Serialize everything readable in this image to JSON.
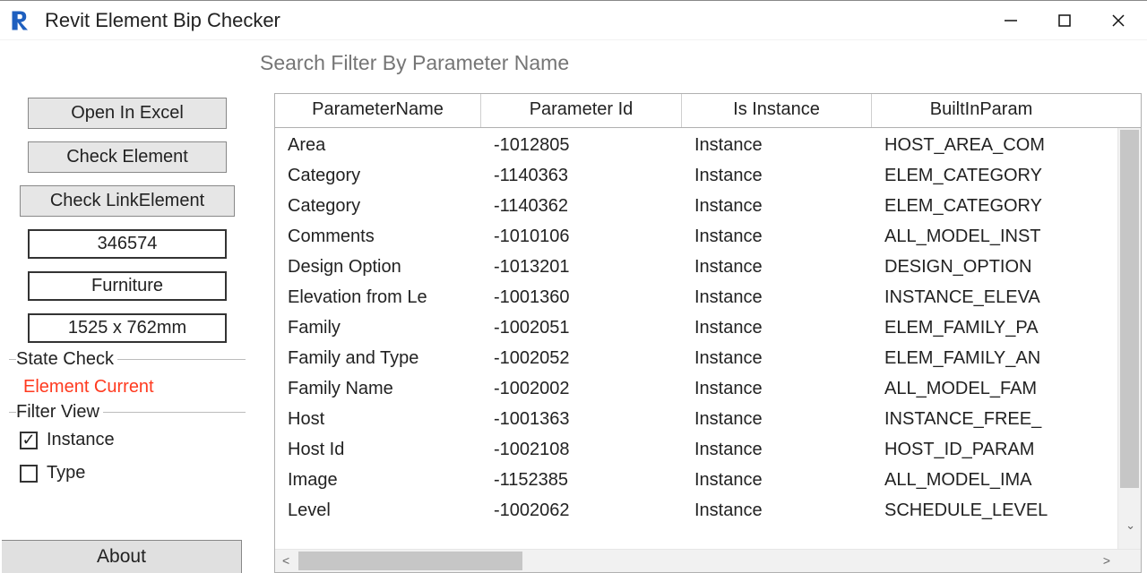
{
  "window": {
    "title": "Revit Element Bip Checker"
  },
  "search": {
    "placeholder": "Search Filter By Parameter Name"
  },
  "sidebar": {
    "open_excel": "Open In Excel",
    "check_element": "Check Element",
    "check_link": "Check LinkElement",
    "element_id": "346574",
    "category": "Furniture",
    "type_name": "1525 x 762mm",
    "state_group": "State Check",
    "state_value": "Element Current",
    "filter_group": "Filter View",
    "instance_label": "Instance",
    "type_label": "Type",
    "instance_checked": true,
    "type_checked": false,
    "about": "About"
  },
  "grid": {
    "columns": [
      "ParameterName",
      "Parameter Id",
      "Is Instance",
      "BuiltInParam"
    ],
    "rows": [
      {
        "name": "Area",
        "id": "-1012805",
        "inst": "Instance",
        "bip": "HOST_AREA_COM"
      },
      {
        "name": "Category",
        "id": "-1140363",
        "inst": "Instance",
        "bip": "ELEM_CATEGORY"
      },
      {
        "name": "Category",
        "id": "-1140362",
        "inst": "Instance",
        "bip": "ELEM_CATEGORY"
      },
      {
        "name": "Comments",
        "id": "-1010106",
        "inst": "Instance",
        "bip": "ALL_MODEL_INST"
      },
      {
        "name": "Design Option",
        "id": "-1013201",
        "inst": "Instance",
        "bip": "DESIGN_OPTION"
      },
      {
        "name": "Elevation from Le",
        "id": "-1001360",
        "inst": "Instance",
        "bip": "INSTANCE_ELEVA"
      },
      {
        "name": "Family",
        "id": "-1002051",
        "inst": "Instance",
        "bip": "ELEM_FAMILY_PA"
      },
      {
        "name": "Family and Type",
        "id": "-1002052",
        "inst": "Instance",
        "bip": "ELEM_FAMILY_AN"
      },
      {
        "name": "Family Name",
        "id": "-1002002",
        "inst": "Instance",
        "bip": "ALL_MODEL_FAM"
      },
      {
        "name": "Host",
        "id": "-1001363",
        "inst": "Instance",
        "bip": "INSTANCE_FREE_"
      },
      {
        "name": "Host Id",
        "id": "-1002108",
        "inst": "Instance",
        "bip": "HOST_ID_PARAM"
      },
      {
        "name": "Image",
        "id": "-1152385",
        "inst": "Instance",
        "bip": "ALL_MODEL_IMA"
      },
      {
        "name": "Level",
        "id": "-1002062",
        "inst": "Instance",
        "bip": "SCHEDULE_LEVEL"
      }
    ]
  }
}
